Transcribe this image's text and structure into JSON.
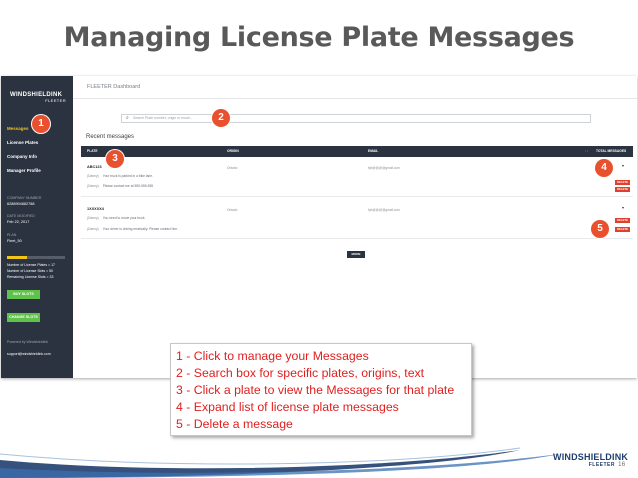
{
  "slide": {
    "title": "Managing License Plate Messages",
    "page_number": "16"
  },
  "app": {
    "logo_main": "WINDSHIELDINK",
    "logo_sub": "FLEETER",
    "dashboard_title": "FLEETER Dashboard"
  },
  "sidebar": {
    "nav": [
      {
        "label": "Messages",
        "active": true
      },
      {
        "label": "License Plates",
        "active": false
      },
      {
        "label": "Company Info",
        "active": false
      },
      {
        "label": "Manager Profile",
        "active": false
      }
    ],
    "company_number_label": "COMPANY NUMBER",
    "company_number": "6288994882788",
    "date_modified_label": "DATE MODIFIED",
    "date_modified": "Feb 22, 2017",
    "plan_label": "PLAN",
    "plan": "Fleet_50",
    "license_usage_fraction": 0.34,
    "stats": [
      "Number of License Plates = 17",
      "Number of License Slots = 50",
      "Remaining License Slots = 33"
    ],
    "buy_slots_label": "BUY SLOTS",
    "change_slots_label": "CHANGE SLOTS",
    "powered_by": "Powered by Windshieldink",
    "support_email": "support@windshieldink.com"
  },
  "main": {
    "search_placeholder": "Search Plate number, origin or email...",
    "section_title": "Recent messages",
    "table_headers": {
      "plate": "PLATE",
      "origin": "ORIGIN",
      "email": "EMAIL",
      "sort": "↑↓",
      "total": "TOTAL MESSAGES"
    },
    "rows": [
      {
        "plate": "ABC123",
        "origin": "Ontario",
        "email": "fpb@@@@gmail.com",
        "messages": [
          {
            "tag": "(Danny)",
            "text": "Your truck is parked in a bike lane."
          },
          {
            "tag": "(Danny)",
            "text": "Please contact me at 555-555-555"
          }
        ]
      },
      {
        "plate": "1XXXXX4",
        "origin": "Ontario",
        "email": "fpb@@@@gmail.com",
        "messages": [
          {
            "tag": "(Danny)",
            "text": "You need to move your truck."
          },
          {
            "tag": "(Danny)",
            "text": "Your driver is driving erratically. Please contact him."
          }
        ]
      }
    ],
    "delete_label": "DELETE",
    "caret_glyph": "▾",
    "more_label": "MORE"
  },
  "badges": [
    "1",
    "2",
    "3",
    "4",
    "5"
  ],
  "callout": {
    "lines": [
      "1 - Click to manage your Messages",
      "2 - Search box for specific plates, origins, text",
      "3 - Click a plate to view the Messages for that plate",
      "4 - Expand list of license plate messages",
      "5 - Delete a message"
    ]
  },
  "brand": {
    "main": "WINDSHIELDINK",
    "sub": "FLEETER"
  },
  "colors": {
    "sidebar_bg": "#2b3340",
    "accent_yellow": "#f0c419",
    "badge_orange": "#e8502e",
    "delete_red": "#e0402c",
    "button_green": "#5fc24b",
    "callout_text": "#e02020",
    "title_gray": "#595959"
  }
}
